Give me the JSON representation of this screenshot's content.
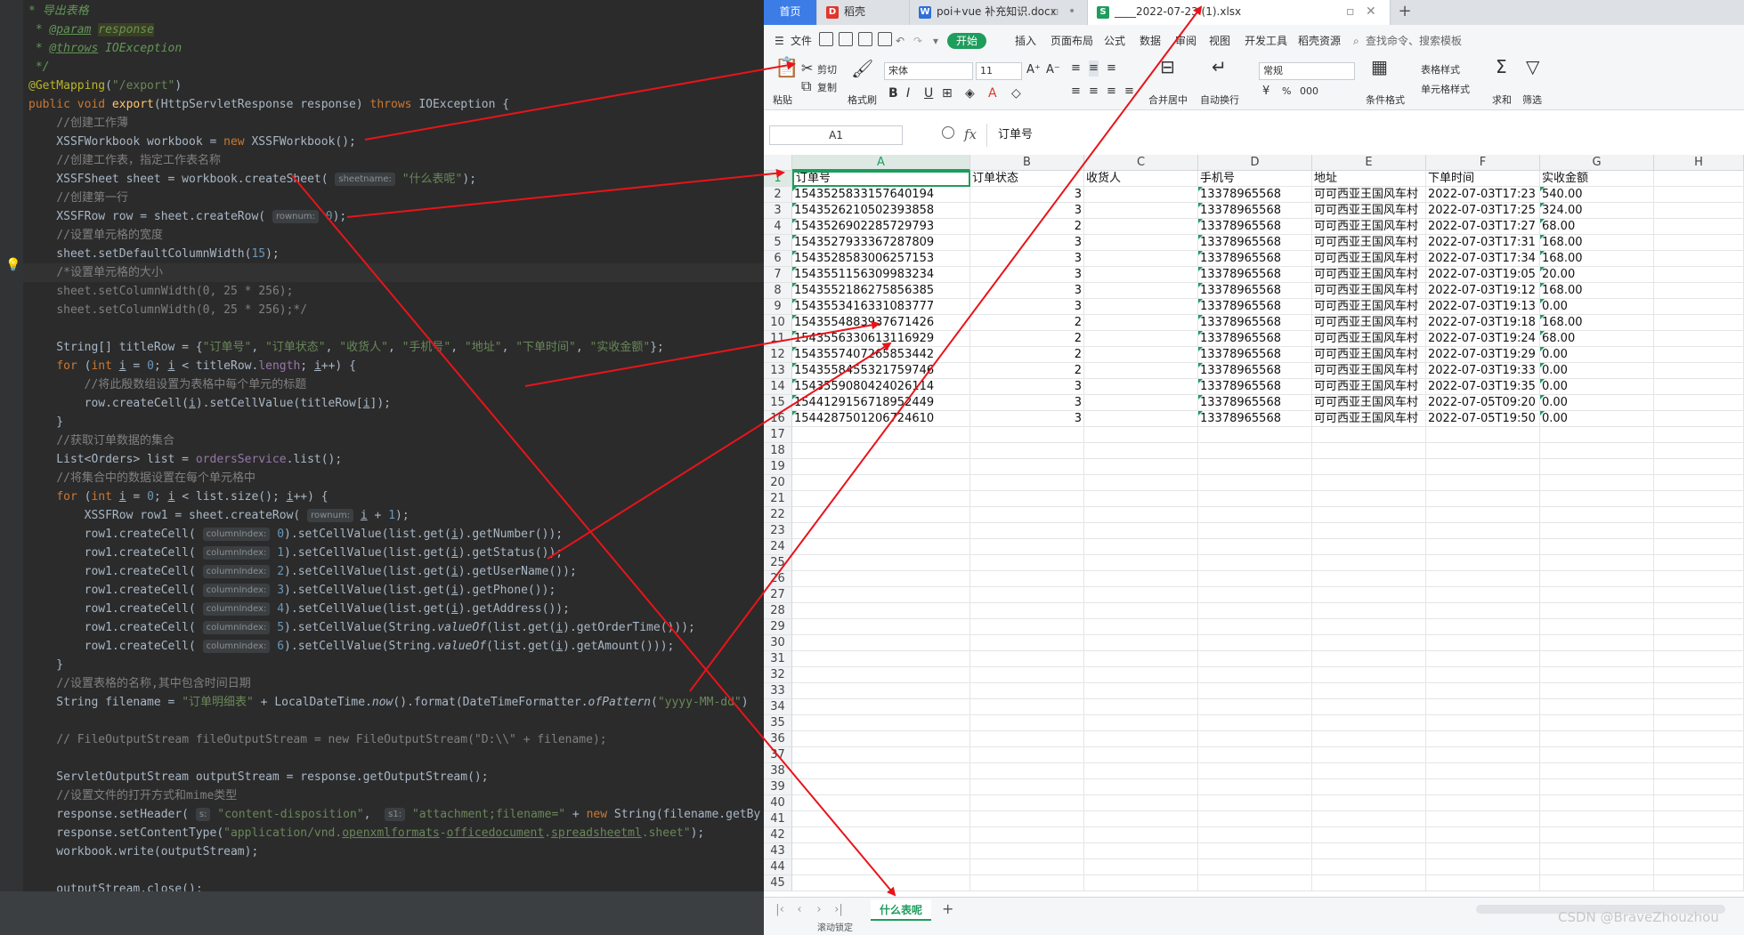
{
  "editor": {
    "lines": [
      {
        "html": "<span class=\"cd\">* 导出表格</span>"
      },
      {
        "html": "<span class=\"cd\"> * <span class=\"ul\">@param</span> <span class=\"tagbg\">response</span></span>"
      },
      {
        "html": "<span class=\"cd\"> * <span class=\"ul\">@throws</span> <span class=\"it\">IOException</span></span>"
      },
      {
        "html": "<span class=\"cd\"> */</span>"
      },
      {
        "html": "<span class=\"an\">@GetMapping</span>(<span class=\"s\">\"/export\"</span>)"
      },
      {
        "html": "<span class=\"k\">public void </span><span class=\"fn\">export</span>(HttpServletResponse response) <span class=\"k\">throws </span>IOException {"
      },
      {
        "html": "    <span class=\"c\">//创建工作薄</span>"
      },
      {
        "html": "    XSSFWorkbook workbook = <span class=\"k\">new </span>XSSFWorkbook();"
      },
      {
        "html": "    <span class=\"c\">//创建工作表，指定工作表名称</span>"
      },
      {
        "html": "    XSSFSheet sheet = workbook.createSheet( <span class=\"hint\">sheetname:</span> <span class=\"s\">\"什么表呢\"</span>);"
      },
      {
        "html": "    <span class=\"c\">//创建第一行</span>"
      },
      {
        "html": "    XSSFRow row = sheet.createRow( <span class=\"hint\">rownum:</span> <span class=\"nm\">0</span>);"
      },
      {
        "html": "    <span class=\"c\">//设置单元格的宽度</span>"
      },
      {
        "html": "    sheet.setDefaultColumnWidth(<span class=\"nm\">15</span>);"
      },
      {
        "html": "    <span class=\"c\">/*设置单元格的大小</span>",
        "hl": true
      },
      {
        "html": "    <span class=\"c\">sheet.setColumnWidth(0, 25 * 256);</span>"
      },
      {
        "html": "    <span class=\"c\">sheet.setColumnWidth(0, 25 * 256);*/</span>"
      },
      {
        "html": ""
      },
      {
        "html": "    String[] titleRow = {<span class=\"s\">\"订单号\"</span>, <span class=\"s\">\"订单状态\"</span>, <span class=\"s\">\"收货人\"</span>, <span class=\"s\">\"手机号\"</span>, <span class=\"s\">\"地址\"</span>, <span class=\"s\">\"下单时间\"</span>, <span class=\"s\">\"实收金额\"</span>};"
      },
      {
        "html": "    <span class=\"k\">for </span>(<span class=\"k\">int </span><span class=\"ul\">i</span> = <span class=\"nm\">0</span>; <span class=\"ul\">i</span> &lt; titleRow.<span class=\"fld\">length</span>; <span class=\"ul\">i</span>++) {"
      },
      {
        "html": "        <span class=\"c\">//将此殷数组设置为表格中每个单元的标题</span>"
      },
      {
        "html": "        row.createCell(<span class=\"ul\">i</span>).setCellValue(titleRow[<span class=\"ul\">i</span>]);"
      },
      {
        "html": "    }"
      },
      {
        "html": "    <span class=\"c\">//获取订单数据的集合</span>"
      },
      {
        "html": "    List&lt;Orders&gt; list = <span class=\"fld\">ordersService</span>.list();"
      },
      {
        "html": "    <span class=\"c\">//将集合中的数据设置在每个单元格中</span>"
      },
      {
        "html": "    <span class=\"k\">for </span>(<span class=\"k\">int </span><span class=\"ul\">i</span> = <span class=\"nm\">0</span>; <span class=\"ul\">i</span> &lt; list.size(); <span class=\"ul\">i</span>++) {"
      },
      {
        "html": "        XSSFRow row1 = sheet.createRow( <span class=\"hint\">rownum:</span> <span class=\"ul\">i</span> + <span class=\"nm\">1</span>);"
      },
      {
        "html": "        row1.createCell( <span class=\"hint\">columnIndex:</span> <span class=\"nm\">0</span>).setCellValue(list.get(<span class=\"ul\">i</span>).getNumber());"
      },
      {
        "html": "        row1.createCell( <span class=\"hint\">columnIndex:</span> <span class=\"nm\">1</span>).setCellValue(list.get(<span class=\"ul\">i</span>).getStatus());"
      },
      {
        "html": "        row1.createCell( <span class=\"hint\">columnIndex:</span> <span class=\"nm\">2</span>).setCellValue(list.get(<span class=\"ul\">i</span>).getUserName());"
      },
      {
        "html": "        row1.createCell( <span class=\"hint\">columnIndex:</span> <span class=\"nm\">3</span>).setCellValue(list.get(<span class=\"ul\">i</span>).getPhone());"
      },
      {
        "html": "        row1.createCell( <span class=\"hint\">columnIndex:</span> <span class=\"nm\">4</span>).setCellValue(list.get(<span class=\"ul\">i</span>).getAddress());"
      },
      {
        "html": "        row1.createCell( <span class=\"hint\">columnIndex:</span> <span class=\"nm\">5</span>).setCellValue(String.<span class=\"it\">valueOf</span>(list.get(<span class=\"ul\">i</span>).getOrderTime()));"
      },
      {
        "html": "        row1.createCell( <span class=\"hint\">columnIndex:</span> <span class=\"nm\">6</span>).setCellValue(String.<span class=\"it\">valueOf</span>(list.get(<span class=\"ul\">i</span>).getAmount()));"
      },
      {
        "html": "    }"
      },
      {
        "html": "    <span class=\"c\">//设置表格的名称,其中包含时间日期</span>"
      },
      {
        "html": "    String filename = <span class=\"s\">\"订单明细表\"</span> + LocalDateTime.<span class=\"it\">now</span>().format(DateTimeFormatter.<span class=\"it\">ofPattern</span>(<span class=\"s\">\"yyyy-MM-dd\"</span>)"
      },
      {
        "html": ""
      },
      {
        "html": "    <span class=\"c\">// FileOutputStream fileOutputStream = new FileOutputStream(\"D:\\\\\" + filename);</span>"
      },
      {
        "html": ""
      },
      {
        "html": "    ServletOutputStream outputStream = response.getOutputStream();"
      },
      {
        "html": "    <span class=\"c\">//设置文件的打开方式和mime类型</span>"
      },
      {
        "html": "    response.setHeader( <span class=\"hint\">s:</span> <span class=\"s\">\"content-disposition\"</span>,  <span class=\"hint\">s1:</span> <span class=\"s\">\"attachment;filename=\"</span> + <span class=\"k\">new </span>String(filename.getBy"
      },
      {
        "html": "    response.setContentType(<span class=\"s\">\"application/vnd.<span class=\"ul\">openxmlformats</span>-<span class=\"ul\">officedocument</span>.<span class=\"ul\">spreadsheetml</span>.sheet\"</span>);"
      },
      {
        "html": "    workbook.write(outputStream);"
      },
      {
        "html": ""
      },
      {
        "html": "    outputStream.close();"
      }
    ]
  },
  "tabs": {
    "home": "首页",
    "t1": "稻壳",
    "t2": "poi+vue 补充知识.docx",
    "t3": "____2022-07-23 (1).xlsx",
    "newtab": "+"
  },
  "menu": {
    "file": "文件",
    "start": "开始",
    "insert": "插入",
    "layout": "页面布局",
    "formula": "公式",
    "data": "数据",
    "review": "审阅",
    "view": "视图",
    "dev": "开发工具",
    "docer": "稻壳资源",
    "search": "查找命令、搜索模板"
  },
  "ribbon": {
    "paste": "粘贴",
    "cut": "剪切",
    "copy": "复制",
    "format_painter": "格式刷",
    "font": "宋体",
    "size": "11",
    "merge": "合并居中",
    "wrap": "自动换行",
    "numfmt": "常规",
    "table_style": "表格样式",
    "cond_format": "条件格式",
    "cell_style": "单元格样式",
    "sum": "求和",
    "filter": "筛选",
    "percent": "%",
    "thousands": "000"
  },
  "formula": {
    "namebox": "A1",
    "fx": "fx",
    "value": "订单号"
  },
  "columns": [
    "A",
    "B",
    "C",
    "D",
    "E",
    "F",
    "G",
    "H"
  ],
  "table": {
    "rows": [
      [
        "订单号",
        "订单状态",
        "收货人",
        "手机号",
        "地址",
        "下单时间",
        "实收金额"
      ],
      [
        "1543525833157640194",
        "3",
        "",
        "13378965568",
        "可可西亚王国风车村",
        "2022-07-03T17:23",
        "540.00"
      ],
      [
        "1543526210502393858",
        "3",
        "",
        "13378965568",
        "可可西亚王国风车村",
        "2022-07-03T17:25",
        "324.00"
      ],
      [
        "1543526902285729793",
        "2",
        "",
        "13378965568",
        "可可西亚王国风车村",
        "2022-07-03T17:27",
        "68.00"
      ],
      [
        "1543527933367287809",
        "3",
        "",
        "13378965568",
        "可可西亚王国风车村",
        "2022-07-03T17:31",
        "168.00"
      ],
      [
        "1543528583006257153",
        "3",
        "",
        "13378965568",
        "可可西亚王国风车村",
        "2022-07-03T17:34",
        "168.00"
      ],
      [
        "1543551156309983234",
        "3",
        "",
        "13378965568",
        "可可西亚王国风车村",
        "2022-07-03T19:05",
        "20.00"
      ],
      [
        "1543552186275856385",
        "3",
        "",
        "13378965568",
        "可可西亚王国风车村",
        "2022-07-03T19:12",
        "168.00"
      ],
      [
        "1543553416331083777",
        "3",
        "",
        "13378965568",
        "可可西亚王国风车村",
        "2022-07-03T19:13",
        "0.00"
      ],
      [
        "1543554883937671426",
        "2",
        "",
        "13378965568",
        "可可西亚王国风车村",
        "2022-07-03T19:18",
        "168.00"
      ],
      [
        "1543556330613116929",
        "2",
        "",
        "13378965568",
        "可可西亚王国风车村",
        "2022-07-03T19:24",
        "68.00"
      ],
      [
        "1543557407265853442",
        "2",
        "",
        "13378965568",
        "可可西亚王国风车村",
        "2022-07-03T19:29",
        "0.00"
      ],
      [
        "1543558455321759746",
        "2",
        "",
        "13378965568",
        "可可西亚王国风车村",
        "2022-07-03T19:33",
        "0.00"
      ],
      [
        "1543559080424026114",
        "3",
        "",
        "13378965568",
        "可可西亚王国风车村",
        "2022-07-03T19:35",
        "0.00"
      ],
      [
        "1544129156718952449",
        "3",
        "",
        "13378965568",
        "可可西亚王国风车村",
        "2022-07-05T09:20",
        "0.00"
      ],
      [
        "1544287501206724610",
        "3",
        "",
        "13378965568",
        "可可西亚王国风车村",
        "2022-07-05T19:50",
        "0.00"
      ]
    ],
    "row_count": 45
  },
  "sheet": {
    "tab_name": "什么表呢",
    "add": "+"
  },
  "status": {
    "text": "滚动锁定"
  },
  "watermark": "CSDN @BraveZhouzhou",
  "colors": {
    "editor_bg": "#2b2b2b",
    "accent_green": "#1e9d5c",
    "home_tab_blue": "#3b7ce6",
    "arrow_red": "#e8141a"
  }
}
